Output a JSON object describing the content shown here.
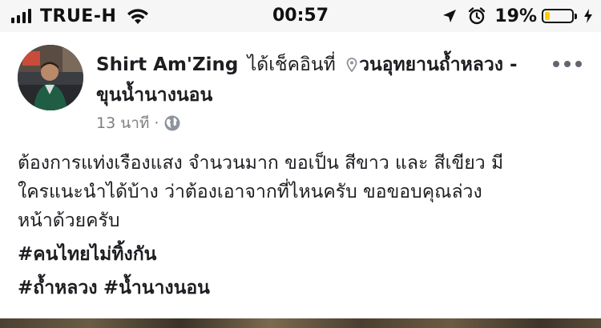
{
  "status_bar": {
    "carrier": "TRUE-H",
    "time": "00:57",
    "battery_percent_label": "19%",
    "battery_level": 0.19,
    "icons": [
      "signal-icon",
      "wifi-icon",
      "location-arrow-icon",
      "alarm-icon",
      "battery-icon",
      "charging-icon"
    ]
  },
  "post": {
    "author": "Shirt Am'Zing",
    "checkin_text": "ได้เช็คอินที่",
    "place": "วนอุทยานถ้ำหลวง - ขุนน้ำนางนอน",
    "timestamp": "13 นาที",
    "meta_separator": "·",
    "privacy_icon": "globe-icon",
    "body_line1": "ต้องการแท่งเรืองแสง จำนวนมาก ขอเป็น สีขาว และ สีเขียว มี",
    "body_line2": "ใครแนะนำได้บ้าง ว่าต้องเอาจากที่ไหนครับ  ขอขอบคุณล่วง",
    "body_line3": "หน้าด้วยครับ",
    "hashtag1": "#คนไทยไม่ทิ้งกัน",
    "hashtag2": "#ถ้ำหลวง",
    "hashtag3": "#น้ำนางนอน"
  },
  "colors": {
    "status_bar_bg": "#f6f6f7",
    "battery_fill": "#ffcc00",
    "text_primary": "#1c1e21",
    "text_secondary": "#7f7f7f"
  }
}
